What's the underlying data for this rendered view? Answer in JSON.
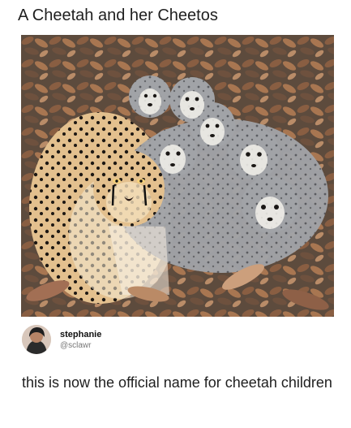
{
  "post": {
    "title": "A Cheetah and her Cheetos",
    "photo_subject": "cheetah-with-cubs-photo"
  },
  "author": {
    "display_name": "stephanie",
    "handle": "@sclawr"
  },
  "tweet": {
    "text": "this is now the official name for cheetah children"
  },
  "colors": {
    "text": "#1f1f1f",
    "handle_text": "#777777",
    "background": "#ffffff",
    "leaf_dark": "#5a4536",
    "leaf_orange": "#b8734a",
    "cheetah_fur": "#d7b17d",
    "cub_fur": "#9ea0a3"
  }
}
